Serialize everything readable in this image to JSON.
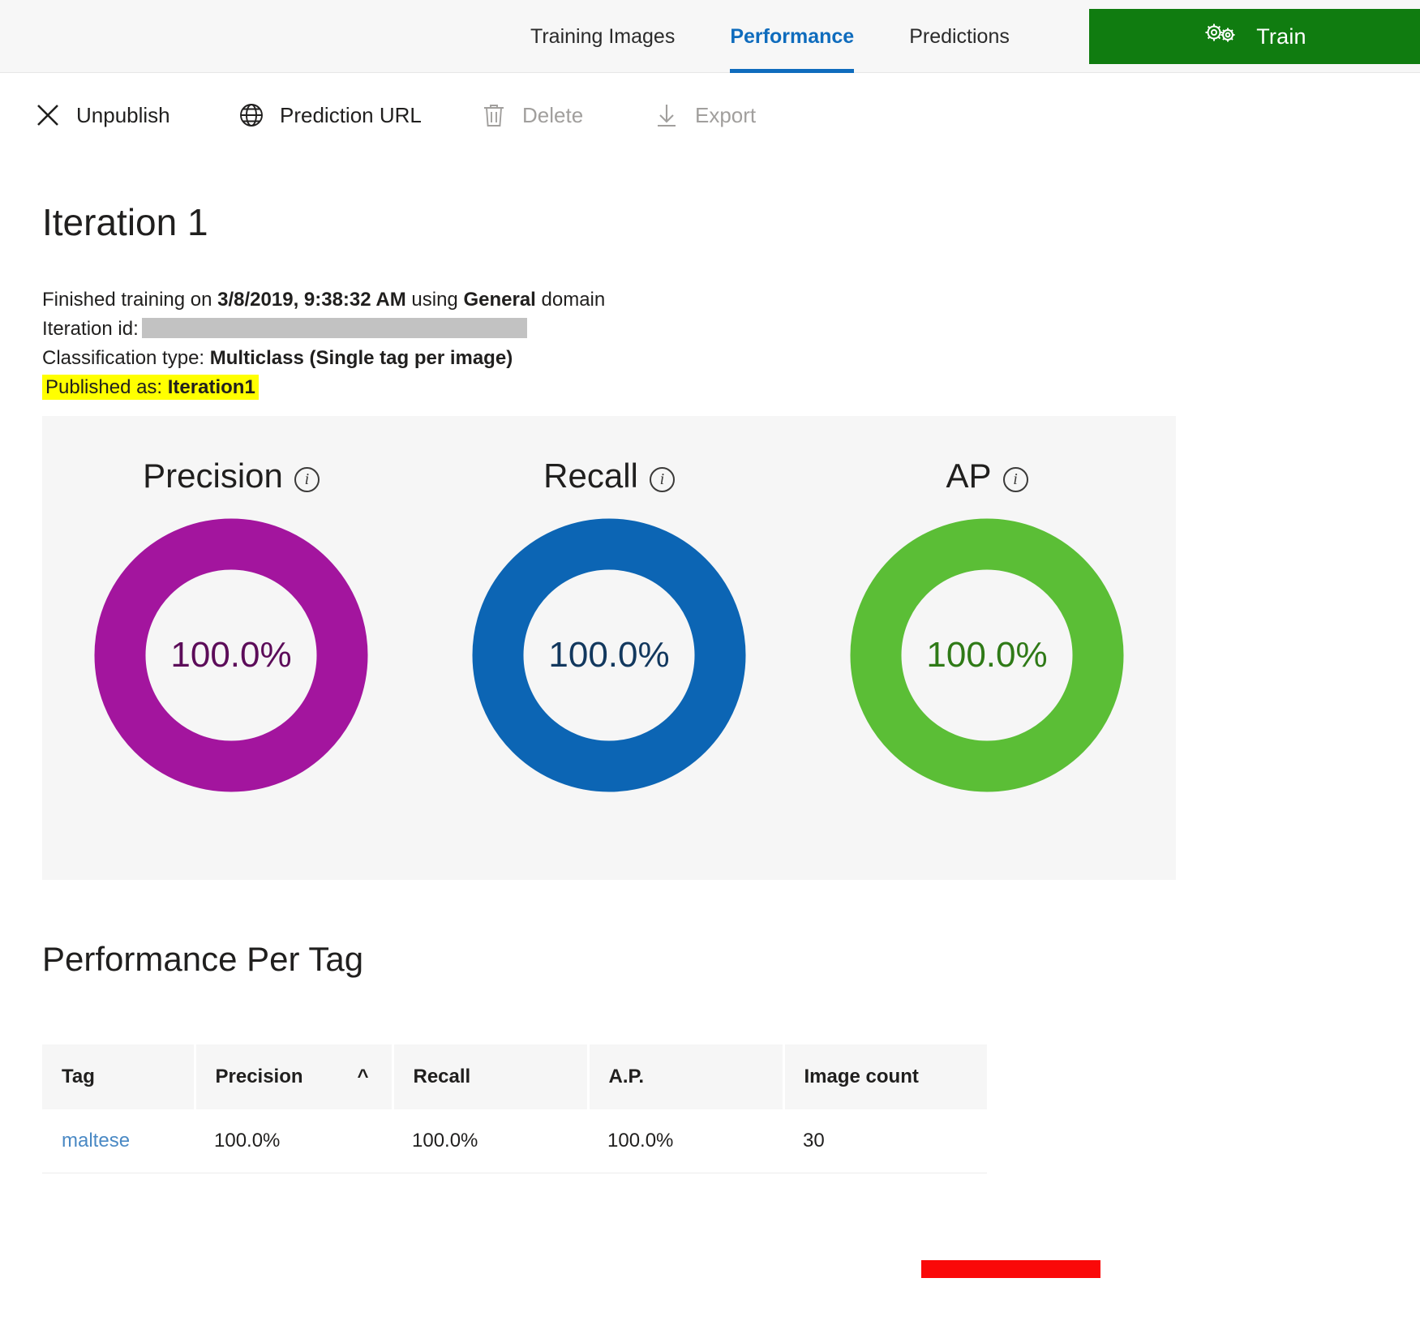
{
  "header": {
    "tabs": [
      {
        "label": "Training Images",
        "active": false
      },
      {
        "label": "Performance",
        "active": true
      },
      {
        "label": "Predictions",
        "active": false
      }
    ],
    "train_button": {
      "label": "Train",
      "icon": "gears-icon",
      "color": "#107c10"
    },
    "accent_color": "#0f6cbd"
  },
  "commandbar": {
    "unpublish": {
      "label": "Unpublish",
      "icon": "close-x-icon",
      "disabled": false
    },
    "prediction_url": {
      "label": "Prediction URL",
      "icon": "globe-icon",
      "disabled": false
    },
    "delete": {
      "label": "Delete",
      "icon": "trash-icon",
      "disabled": true
    },
    "export": {
      "label": "Export",
      "icon": "download-arrow-icon",
      "disabled": true
    }
  },
  "iteration": {
    "title": "Iteration 1",
    "finished_prefix": "Finished training on ",
    "finished_datetime": "3/8/2019, 9:38:32 AM",
    "finished_mid": " using ",
    "domain_name": "General",
    "finished_suffix": " domain",
    "iteration_id_label": "Iteration id:",
    "iteration_id_value": "",
    "classification_type_label": "Classification type: ",
    "classification_type_value": "Multiclass (Single tag per image)",
    "published_as_label": "Published as: ",
    "published_as_value": "Iteration1",
    "highlight_color": "#ffff00"
  },
  "metrics": [
    {
      "name": "Precision",
      "value": "100.0%",
      "color": "#a3159e",
      "text_color": "#5c0c59",
      "info_icon": "info-icon"
    },
    {
      "name": "Recall",
      "value": "100.0%",
      "color": "#0c65b4",
      "text_color": "#12385e",
      "info_icon": "info-icon"
    },
    {
      "name": "AP",
      "value": "100.0%",
      "color": "#5bbe36",
      "text_color": "#2f7a17",
      "info_icon": "info-icon"
    }
  ],
  "per_tag": {
    "section_title": "Performance Per Tag",
    "columns": [
      {
        "label": "Tag",
        "sort": ""
      },
      {
        "label": "Precision",
        "sort": "^"
      },
      {
        "label": "Recall",
        "sort": ""
      },
      {
        "label": "A.P.",
        "sort": ""
      },
      {
        "label": "Image count",
        "sort": ""
      }
    ],
    "rows": [
      {
        "tag": "maltese",
        "precision": "100.0%",
        "recall": "100.0%",
        "ap": "100.0%",
        "image_count": "30"
      }
    ]
  },
  "annotation": {
    "shape": "red-rectangle",
    "color": "#fa0909"
  },
  "chart_data": {
    "type": "pie",
    "title": "Iteration 1 overall performance",
    "categories": [
      "Precision",
      "Recall",
      "AP"
    ],
    "values": [
      100.0,
      100.0,
      100.0
    ],
    "unit": "%",
    "colors": [
      "#a3159e",
      "#0c65b4",
      "#5bbe36"
    ],
    "legend": "none",
    "note": "Three donut gauges, each filled to 100%"
  }
}
